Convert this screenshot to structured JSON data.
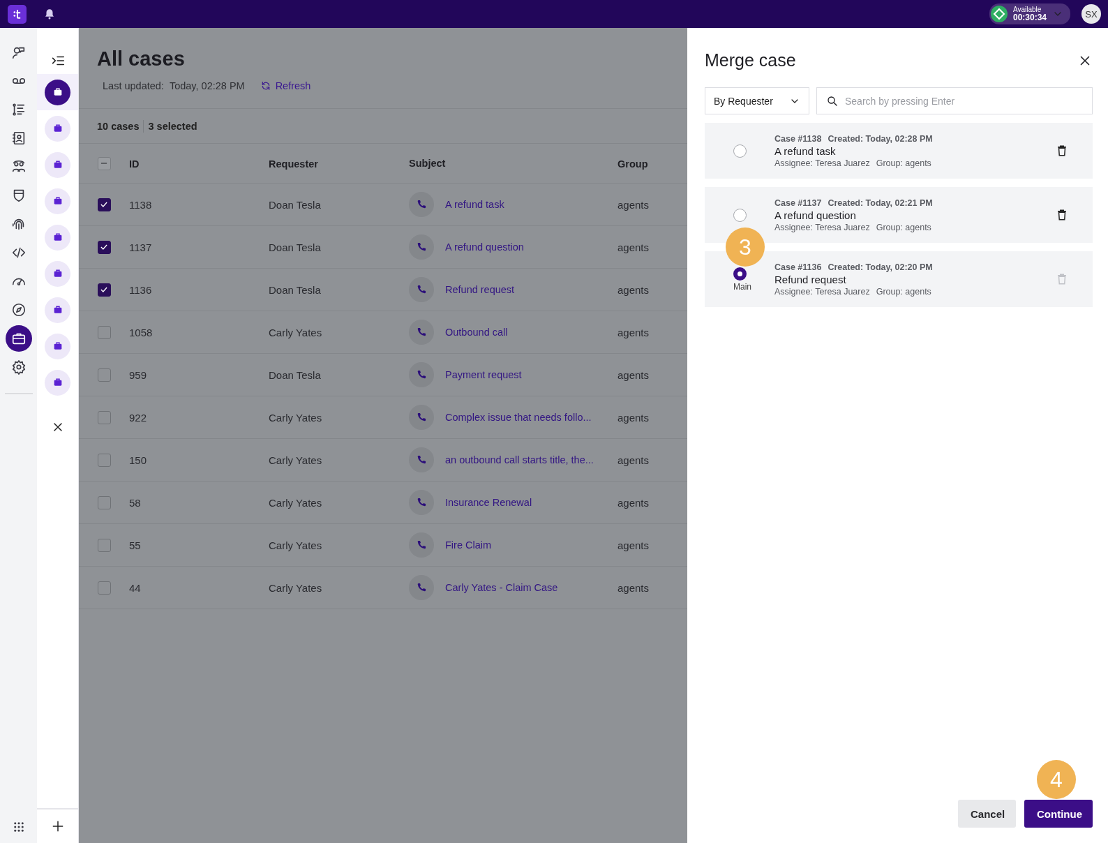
{
  "topbar": {
    "status": {
      "label": "Available",
      "timer": "00:30:34"
    },
    "avatar": "SX"
  },
  "rail": [
    {
      "selected": false
    },
    {
      "selected": false
    },
    {
      "selected": false
    },
    {
      "selected": false
    },
    {
      "selected": false
    },
    {
      "selected": false
    },
    {
      "selected": false
    },
    {
      "selected": false
    },
    {
      "selected": false
    },
    {
      "selected": false
    },
    {
      "selected": true
    },
    {
      "selected": false
    }
  ],
  "case_tabs": [
    {
      "selected": true
    },
    {
      "selected": false
    },
    {
      "selected": false
    },
    {
      "selected": false
    },
    {
      "selected": false
    },
    {
      "selected": false
    },
    {
      "selected": false
    },
    {
      "selected": false
    },
    {
      "selected": false
    }
  ],
  "main": {
    "title": "All cases",
    "last_updated_label": "Last updated:",
    "last_updated_value": "Today, 02:28 PM",
    "refresh": "Refresh",
    "count": "10 cases",
    "selected_count": "3 selected",
    "table": {
      "header_checkbox": {
        "indeterminate": true
      },
      "columns": [
        "ID",
        "Requester",
        "Subject",
        "Group"
      ],
      "rows": [
        {
          "checked": true,
          "id": "1138",
          "requester": "Doan Tesla",
          "subject": "A refund task",
          "group": "agents"
        },
        {
          "checked": true,
          "id": "1137",
          "requester": "Doan Tesla",
          "subject": "A refund question",
          "group": "agents"
        },
        {
          "checked": true,
          "id": "1136",
          "requester": "Doan Tesla",
          "subject": "Refund request",
          "group": "agents"
        },
        {
          "checked": false,
          "id": "1058",
          "requester": "Carly Yates",
          "subject": "Outbound call",
          "group": "agents"
        },
        {
          "checked": false,
          "id": "959",
          "requester": "Doan Tesla",
          "subject": "Payment request",
          "group": "agents"
        },
        {
          "checked": false,
          "id": "922",
          "requester": "Carly Yates",
          "subject": "Complex issue that needs follo...",
          "group": "agents"
        },
        {
          "checked": false,
          "id": "150",
          "requester": "Carly Yates",
          "subject": "an outbound call starts title, the...",
          "group": "agents"
        },
        {
          "checked": false,
          "id": "58",
          "requester": "Carly Yates",
          "subject": "Insurance Renewal",
          "group": "agents"
        },
        {
          "checked": false,
          "id": "55",
          "requester": "Carly Yates",
          "subject": "Fire Claim",
          "group": "agents"
        },
        {
          "checked": false,
          "id": "44",
          "requester": "Carly Yates",
          "subject": "Carly Yates - Claim Case",
          "group": "agents"
        }
      ]
    }
  },
  "dialog": {
    "title": "Merge case",
    "filter": "By Requester",
    "search": {
      "placeholder": "Search by pressing Enter"
    },
    "cases": [
      {
        "selected": false,
        "case_no": "Case #1138",
        "created": "Created: Today, 02:28 PM",
        "subject": "A refund task",
        "assignee": "Assignee: Teresa Juarez",
        "group": "Group: agents",
        "delete_disabled": false
      },
      {
        "selected": false,
        "case_no": "Case #1137",
        "created": "Created: Today, 02:21 PM",
        "subject": "A refund question",
        "assignee": "Assignee: Teresa Juarez",
        "group": "Group: agents",
        "delete_disabled": false
      },
      {
        "selected": true,
        "main_label": "Main",
        "step": "3",
        "case_no": "Case #1136",
        "created": "Created: Today, 02:20 PM",
        "subject": "Refund request",
        "assignee": "Assignee: Teresa Juarez",
        "group": "Group: agents",
        "delete_disabled": true
      }
    ],
    "buttons": [
      {
        "label": "Cancel",
        "kind": "secondary"
      },
      {
        "label": "Continue",
        "kind": "primary",
        "step": "4"
      }
    ]
  }
}
